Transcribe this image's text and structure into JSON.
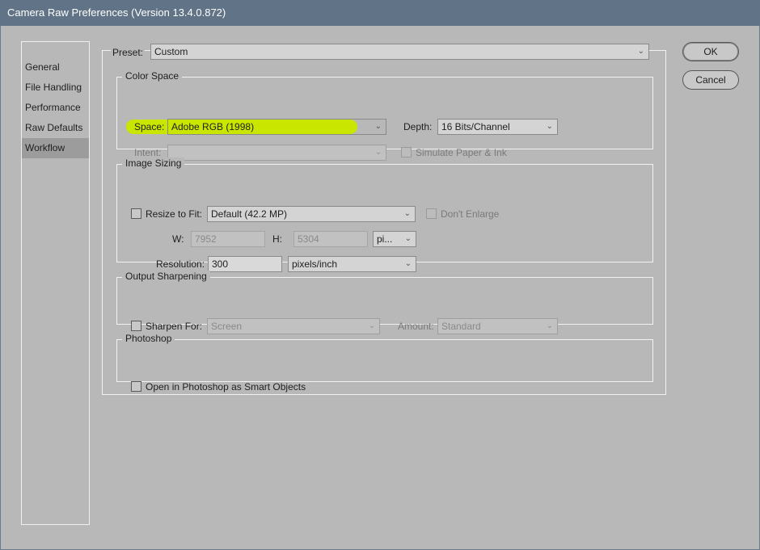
{
  "window": {
    "title": "Camera Raw Preferences  (Version 13.4.0.872)"
  },
  "sidebar": {
    "items": [
      {
        "label": "General"
      },
      {
        "label": "File Handling"
      },
      {
        "label": "Performance"
      },
      {
        "label": "Raw Defaults"
      },
      {
        "label": "Workflow"
      }
    ],
    "selected": "Workflow"
  },
  "preset": {
    "label": "Preset:",
    "value": "Custom"
  },
  "buttons": {
    "ok": "OK",
    "cancel": "Cancel"
  },
  "color_space": {
    "title": "Color Space",
    "space_label": "Space:",
    "space_value": "Adobe RGB (1998)",
    "depth_label": "Depth:",
    "depth_value": "16 Bits/Channel",
    "intent_label": "Intent:",
    "intent_value": "",
    "simulate_label": "Simulate Paper & Ink",
    "highlight_color": "#c9e600"
  },
  "image_sizing": {
    "title": "Image Sizing",
    "resize_label": "Resize to Fit:",
    "resize_value": "Default  (42.2 MP)",
    "dont_enlarge_label": "Don't Enlarge",
    "w_label": "W:",
    "w_value": "7952",
    "h_label": "H:",
    "h_value": "5304",
    "unit_value": "pi...",
    "resolution_label": "Resolution:",
    "resolution_value": "300",
    "resolution_unit": "pixels/inch"
  },
  "output_sharpening": {
    "title": "Output Sharpening",
    "sharpen_label": "Sharpen For:",
    "sharpen_value": "Screen",
    "amount_label": "Amount:",
    "amount_value": "Standard"
  },
  "photoshop": {
    "title": "Photoshop",
    "smart_objects_label": "Open in Photoshop as Smart Objects"
  },
  "icons": {
    "dropdown": "chevron-down-icon"
  }
}
